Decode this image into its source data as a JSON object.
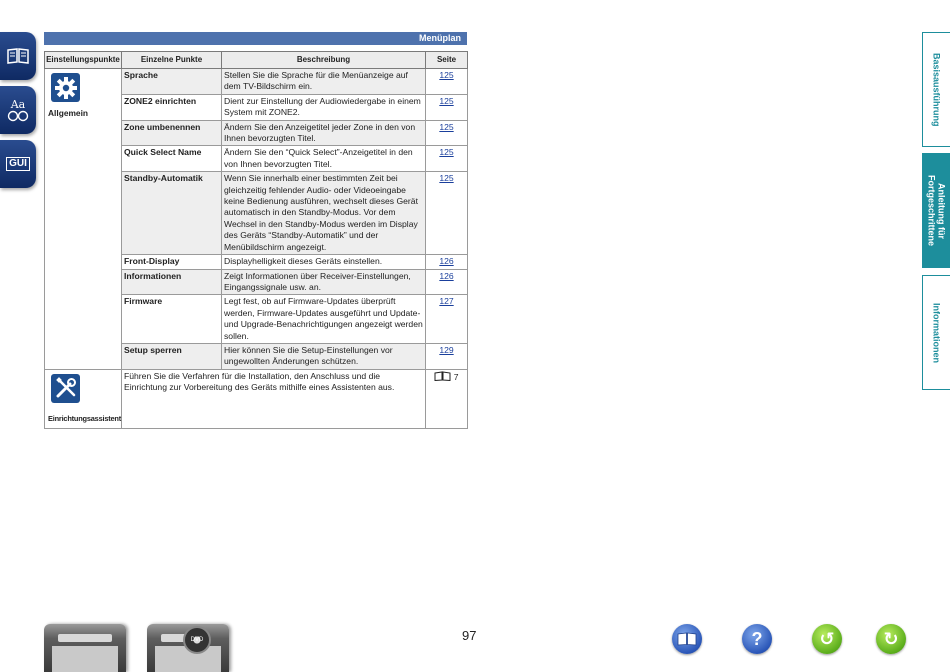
{
  "side_icons": [
    {
      "name": "book-contents-icon"
    },
    {
      "name": "index-icon",
      "label": "Aa"
    },
    {
      "name": "gui-icon",
      "label": "GUI"
    }
  ],
  "header": {
    "title": "Menüplan"
  },
  "table": {
    "columns": [
      "Einstellungspunkte",
      "Einzelne Punkte",
      "Beschreibung",
      "Seite"
    ],
    "categories": [
      {
        "label": "Allgemein",
        "icon": "gear-icon"
      },
      {
        "label": "Einrichtungsassistent",
        "icon": "tools-icon"
      }
    ],
    "rows": [
      {
        "item": "Sprache",
        "description": "Stellen Sie die Sprache für die Menüanzeige auf dem TV-Bildschirm ein.",
        "page": "125"
      },
      {
        "item": "ZONE2 einrichten",
        "description": "Dient zur Einstellung der Audiowiedergabe in einem System mit ZONE2.",
        "page": "125"
      },
      {
        "item": "Zone umbenennen",
        "description": "Ändern Sie den Anzeigetitel jeder Zone in den von Ihnen bevorzugten Titel.",
        "page": "125"
      },
      {
        "item": "Quick Select Name",
        "description": "Ändern Sie den “Quick Select”-Anzeigetitel in den von Ihnen bevorzugten Titel.",
        "page": "125"
      },
      {
        "item": "Standby-Automatik",
        "description": "Wenn Sie innerhalb einer bestimmten Zeit bei gleichzeitig fehlender Audio- oder Videoeingabe keine Bedienung ausführen, wechselt dieses Gerät automatisch in den Standby-Modus. Vor dem Wechsel in den Standby-Modus werden im Display des Geräts “Standby-Automatik” und der Menübildschirm angezeigt.",
        "page": "125"
      },
      {
        "item": "Front-Display",
        "description": "Displayhelligkeit dieses Geräts einstellen.",
        "page": "126"
      },
      {
        "item": "Informationen",
        "description": "Zeigt Informationen über Receiver-Einstellungen, Eingangssignale usw. an.",
        "page": "126"
      },
      {
        "item": "Firmware",
        "description": "Legt fest, ob auf Firmware-Updates überprüft werden, Firmware-Updates ausgeführt und Update- und Upgrade-Benachrichtigungen angezeigt werden sollen.",
        "page": "127"
      },
      {
        "item": "Setup sperren",
        "description": "Hier können Sie die Setup-Einstellungen vor ungewollten Änderungen schützen.",
        "page": "129"
      }
    ],
    "wizard": {
      "description": "Führen Sie die Verfahren für die Installation, den Anschluss und die Einrichtung zur Vorbereitung des Geräts mithilfe eines Assistenten aus.",
      "page": "7",
      "page_icon": "book-icon"
    }
  },
  "right_tabs": [
    {
      "label": "Basisausführung",
      "active": false
    },
    {
      "label": "Anleitung für Fortgeschrittene",
      "active": true
    },
    {
      "label": "Informationen",
      "active": false
    }
  ],
  "footer": {
    "page_number": "97",
    "devices": [
      "receiver-device-icon",
      "dvd-player-device-icon"
    ],
    "disc_label": "DVD",
    "nav_buttons": [
      {
        "name": "contents-book-button",
        "glyph": "📖"
      },
      {
        "name": "help-button",
        "glyph": "?"
      },
      {
        "name": "back-button",
        "glyph": "↺"
      },
      {
        "name": "forward-button",
        "glyph": "↻"
      }
    ]
  },
  "colors": {
    "header_blue": "#4e72ad",
    "tab_teal": "#1d8e9c",
    "link_blue": "#1a3f9c",
    "icon_navy": "#1f4f8f"
  }
}
